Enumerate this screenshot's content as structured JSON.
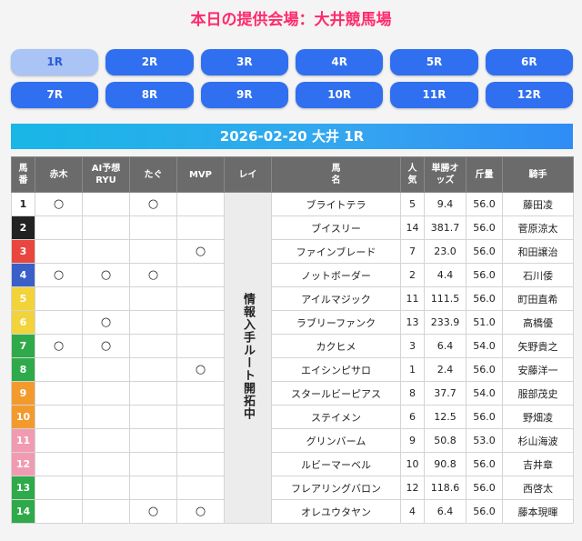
{
  "page_title": "本日の提供会場：大井競馬場",
  "race_buttons": [
    "1R",
    "2R",
    "3R",
    "4R",
    "5R",
    "6R",
    "7R",
    "8R",
    "9R",
    "10R",
    "11R",
    "12R"
  ],
  "active_race": "1R",
  "race_header": "2026-02-20 大井 1R",
  "table": {
    "headers": {
      "num": "馬番",
      "akagi": "赤木",
      "ai": "AI予想RYU",
      "tago": "たぐ",
      "mvp": "MVP",
      "rei": "レイ",
      "horse": "馬名",
      "popularity": "人気",
      "odds": "単勝オッズ",
      "weight": "斤量",
      "jockey": "騎手"
    },
    "rei_text": "情報入手ルート開拓中",
    "rows": [
      {
        "num": "1",
        "color": "#ffffff",
        "text_color": "#222222",
        "akagi": "○",
        "ai": "",
        "tago": "○",
        "mvp": "",
        "horse": "ブライトテラ",
        "pop": "5",
        "odds": "9.4",
        "weight": "56.0",
        "jockey": "藤田凌"
      },
      {
        "num": "2",
        "color": "#222222",
        "text_color": "#ffffff",
        "akagi": "",
        "ai": "",
        "tago": "",
        "mvp": "",
        "horse": "ブイスリー",
        "pop": "14",
        "odds": "381.7",
        "weight": "56.0",
        "jockey": "菅原涼太"
      },
      {
        "num": "3",
        "color": "#e8463f",
        "text_color": "#ffffff",
        "akagi": "",
        "ai": "",
        "tago": "",
        "mvp": "○",
        "horse": "ファインブレード",
        "pop": "7",
        "odds": "23.0",
        "weight": "56.0",
        "jockey": "和田譲治"
      },
      {
        "num": "4",
        "color": "#3a5fc9",
        "text_color": "#ffffff",
        "akagi": "○",
        "ai": "○",
        "tago": "○",
        "mvp": "",
        "horse": "ノットボーダー",
        "pop": "2",
        "odds": "4.4",
        "weight": "56.0",
        "jockey": "石川倭"
      },
      {
        "num": "5",
        "color": "#f2d33a",
        "text_color": "#ffffff",
        "akagi": "",
        "ai": "",
        "tago": "",
        "mvp": "",
        "horse": "アイルマジック",
        "pop": "11",
        "odds": "111.5",
        "weight": "56.0",
        "jockey": "町田直希"
      },
      {
        "num": "6",
        "color": "#f2d33a",
        "text_color": "#ffffff",
        "akagi": "",
        "ai": "○",
        "tago": "",
        "mvp": "",
        "horse": "ラブリーファンク",
        "pop": "13",
        "odds": "233.9",
        "weight": "51.0",
        "jockey": "高橋優"
      },
      {
        "num": "7",
        "color": "#2eaa4a",
        "text_color": "#ffffff",
        "akagi": "○",
        "ai": "○",
        "tago": "",
        "mvp": "",
        "horse": "カクヒメ",
        "pop": "3",
        "odds": "6.4",
        "weight": "54.0",
        "jockey": "矢野貴之"
      },
      {
        "num": "8",
        "color": "#2eaa4a",
        "text_color": "#ffffff",
        "akagi": "",
        "ai": "",
        "tago": "",
        "mvp": "○",
        "horse": "エイシンピサロ",
        "pop": "1",
        "odds": "2.4",
        "weight": "56.0",
        "jockey": "安藤洋一"
      },
      {
        "num": "9",
        "color": "#f39a2c",
        "text_color": "#ffffff",
        "akagi": "",
        "ai": "",
        "tago": "",
        "mvp": "",
        "horse": "スタールビーピアス",
        "pop": "8",
        "odds": "37.7",
        "weight": "54.0",
        "jockey": "服部茂史"
      },
      {
        "num": "10",
        "color": "#f39a2c",
        "text_color": "#ffffff",
        "akagi": "",
        "ai": "",
        "tago": "",
        "mvp": "",
        "horse": "ステイメン",
        "pop": "6",
        "odds": "12.5",
        "weight": "56.0",
        "jockey": "野畑凌"
      },
      {
        "num": "11",
        "color": "#f19bb3",
        "text_color": "#ffffff",
        "akagi": "",
        "ai": "",
        "tago": "",
        "mvp": "",
        "horse": "グリンバーム",
        "pop": "9",
        "odds": "50.8",
        "weight": "53.0",
        "jockey": "杉山海波"
      },
      {
        "num": "12",
        "color": "#f19bb3",
        "text_color": "#ffffff",
        "akagi": "",
        "ai": "",
        "tago": "",
        "mvp": "",
        "horse": "ルビーマーベル",
        "pop": "10",
        "odds": "90.8",
        "weight": "56.0",
        "jockey": "吉井章"
      },
      {
        "num": "13",
        "color": "#2eaa4a",
        "text_color": "#ffffff",
        "akagi": "",
        "ai": "",
        "tago": "",
        "mvp": "",
        "horse": "フレアリングバロン",
        "pop": "12",
        "odds": "118.6",
        "weight": "56.0",
        "jockey": "西啓太"
      },
      {
        "num": "14",
        "color": "#2eaa4a",
        "text_color": "#ffffff",
        "akagi": "",
        "ai": "",
        "tago": "○",
        "mvp": "○",
        "horse": "オレユウタヤン",
        "pop": "4",
        "odds": "6.4",
        "weight": "56.0",
        "jockey": "藤本現暉"
      }
    ]
  }
}
